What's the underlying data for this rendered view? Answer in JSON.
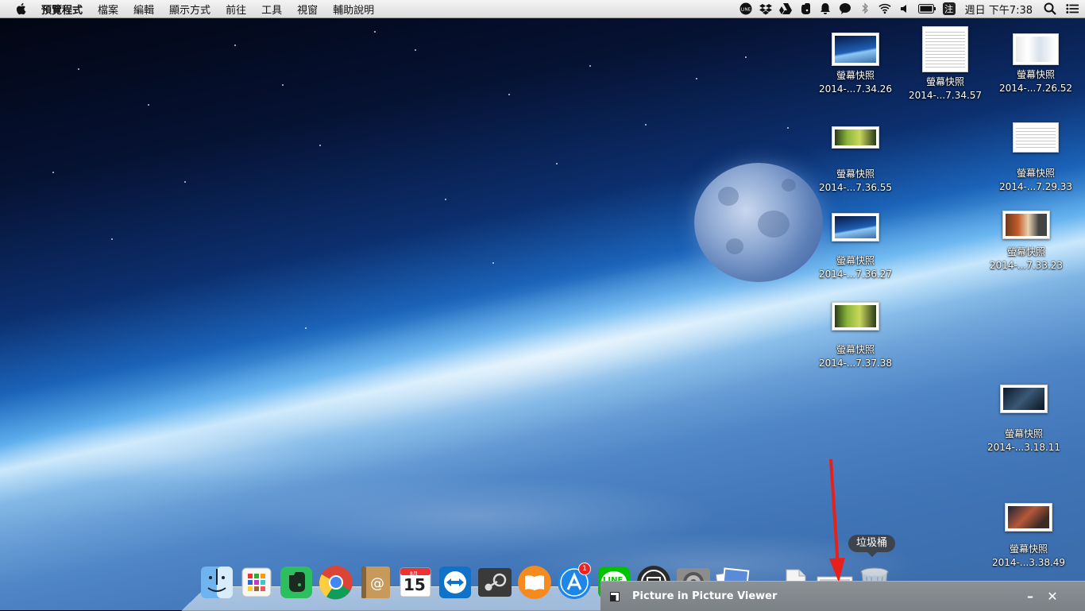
{
  "menubar": {
    "app_menu": "預覽程式",
    "items": [
      "檔案",
      "編輯",
      "顯示方式",
      "前往",
      "工具",
      "視窗",
      "輔助說明"
    ],
    "status_icons": [
      "line-icon",
      "dropbox-icon",
      "google-drive-icon",
      "evernote-icon",
      "notification-bell-icon",
      "speech-bubble-icon",
      "bluetooth-icon",
      "wifi-icon",
      "volume-icon",
      "battery-icon",
      "input-method-icon"
    ],
    "input_method_label": "注",
    "clock": "週日 下午7:38",
    "spotlight": "spotlight-search-icon",
    "notification_center": "notification-center-icon"
  },
  "desktop_icons": [
    {
      "label1": "螢幕快照",
      "label2": "2014-...7.34.26",
      "thumb": "space"
    },
    {
      "label1": "螢幕快照",
      "label2": "2014-...7.34.57",
      "thumb": "doc"
    },
    {
      "label1": "螢幕快照",
      "label2": "2014-...7.26.52",
      "thumb": "web"
    },
    {
      "label1": "螢幕快照",
      "label2": "2014-...7.36.55",
      "thumb": "green"
    },
    {
      "label1": "螢幕快照",
      "label2": "2014-...7.29.33",
      "thumb": "doc"
    },
    {
      "label1": "螢幕快照",
      "label2": "2014-...7.36.27",
      "thumb": "space"
    },
    {
      "label1": "螢幕快照",
      "label2": "2014-...7.33.23",
      "thumb": "mix"
    },
    {
      "label1": "螢幕快照",
      "label2": "2014-...7.37.38",
      "thumb": "green"
    },
    {
      "label1": "螢幕快照",
      "label2": "2014-...3.18.11",
      "thumb": "dark"
    },
    {
      "label1": "螢幕快照",
      "label2": "2014-...3.38.49",
      "thumb": "red"
    }
  ],
  "dock": {
    "items": [
      "finder-icon",
      "launchpad-icon",
      "evernote-icon",
      "chrome-icon",
      "contacts-icon",
      "calendar-icon",
      "teamviewer-icon",
      "steam-icon",
      "ibooks-icon",
      "app-store-icon",
      "line-icon",
      "screen-capture-icon",
      "system-preferences-icon",
      "preview-icon",
      "documents-stack-icon",
      "screenshot-stack-icon",
      "trash-icon"
    ],
    "calendar_day": "15",
    "calendar_month": "8月",
    "app_store_badge": "1",
    "line_label": "LINE",
    "trash_tooltip": "垃圾桶"
  },
  "pip": {
    "title": "Picture in Picture Viewer",
    "minimize": "–",
    "close": "✕"
  },
  "colors": {
    "arrow": "#e8201c",
    "pip_bar": "#858a8f"
  }
}
